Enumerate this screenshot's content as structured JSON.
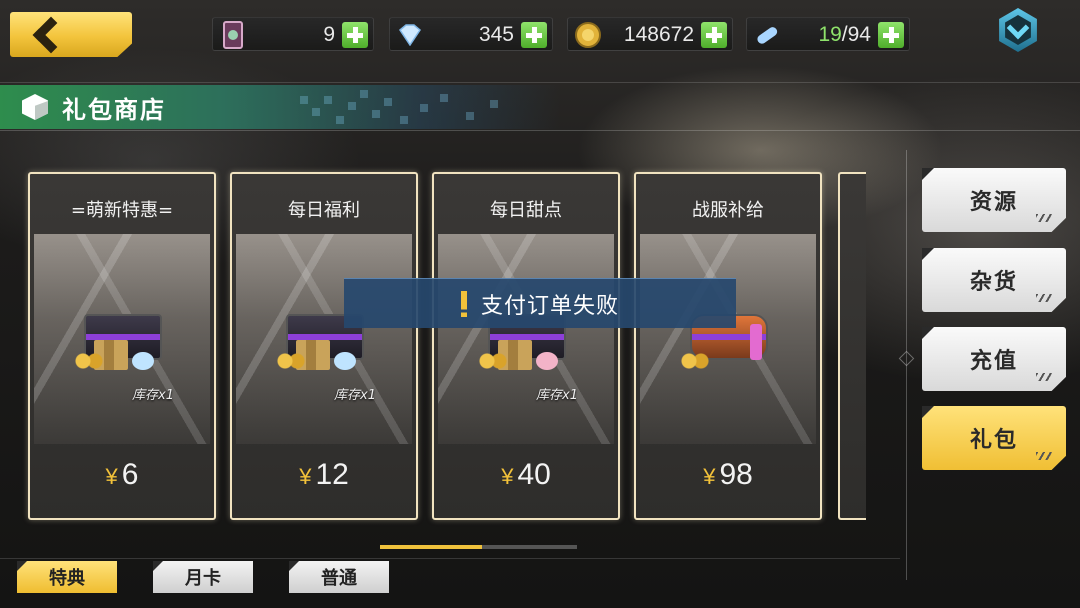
{
  "currencies": [
    {
      "icon": "ticket-icon",
      "value": "9"
    },
    {
      "icon": "diamond-icon",
      "value": "345"
    },
    {
      "icon": "gold-coin-icon",
      "value": "148672"
    },
    {
      "icon": "stamina-capsule-icon",
      "value_highlight": "19",
      "value_rest": "/94"
    }
  ],
  "header": {
    "title": "礼包商店"
  },
  "cards": [
    {
      "name": "=萌新特惠=",
      "stock": "库存x1",
      "currency": "¥",
      "price": "6"
    },
    {
      "name": "每日福利",
      "stock": "库存x1",
      "currency": "¥",
      "price": "12"
    },
    {
      "name": "每日甜点",
      "stock": "库存x1",
      "currency": "¥",
      "price": "40"
    },
    {
      "name": "战服补给",
      "stock": "",
      "currency": "¥",
      "price": "98"
    }
  ],
  "toast": {
    "message": "支付订单失败"
  },
  "scroll": {
    "position": 0.52
  },
  "categories": [
    {
      "label": "资源",
      "active": false
    },
    {
      "label": "杂货",
      "active": false
    },
    {
      "label": "充值",
      "active": false
    },
    {
      "label": "礼包",
      "active": true
    }
  ],
  "tabs": [
    {
      "label": "特典",
      "active": true
    },
    {
      "label": "月卡",
      "active": false
    },
    {
      "label": "普通",
      "active": false
    }
  ],
  "colors": {
    "accent_yellow": "#f3c23a",
    "plus_green": "#5fbf36",
    "header_green": "#2e8d4d",
    "toast_blue": "#26486e"
  }
}
